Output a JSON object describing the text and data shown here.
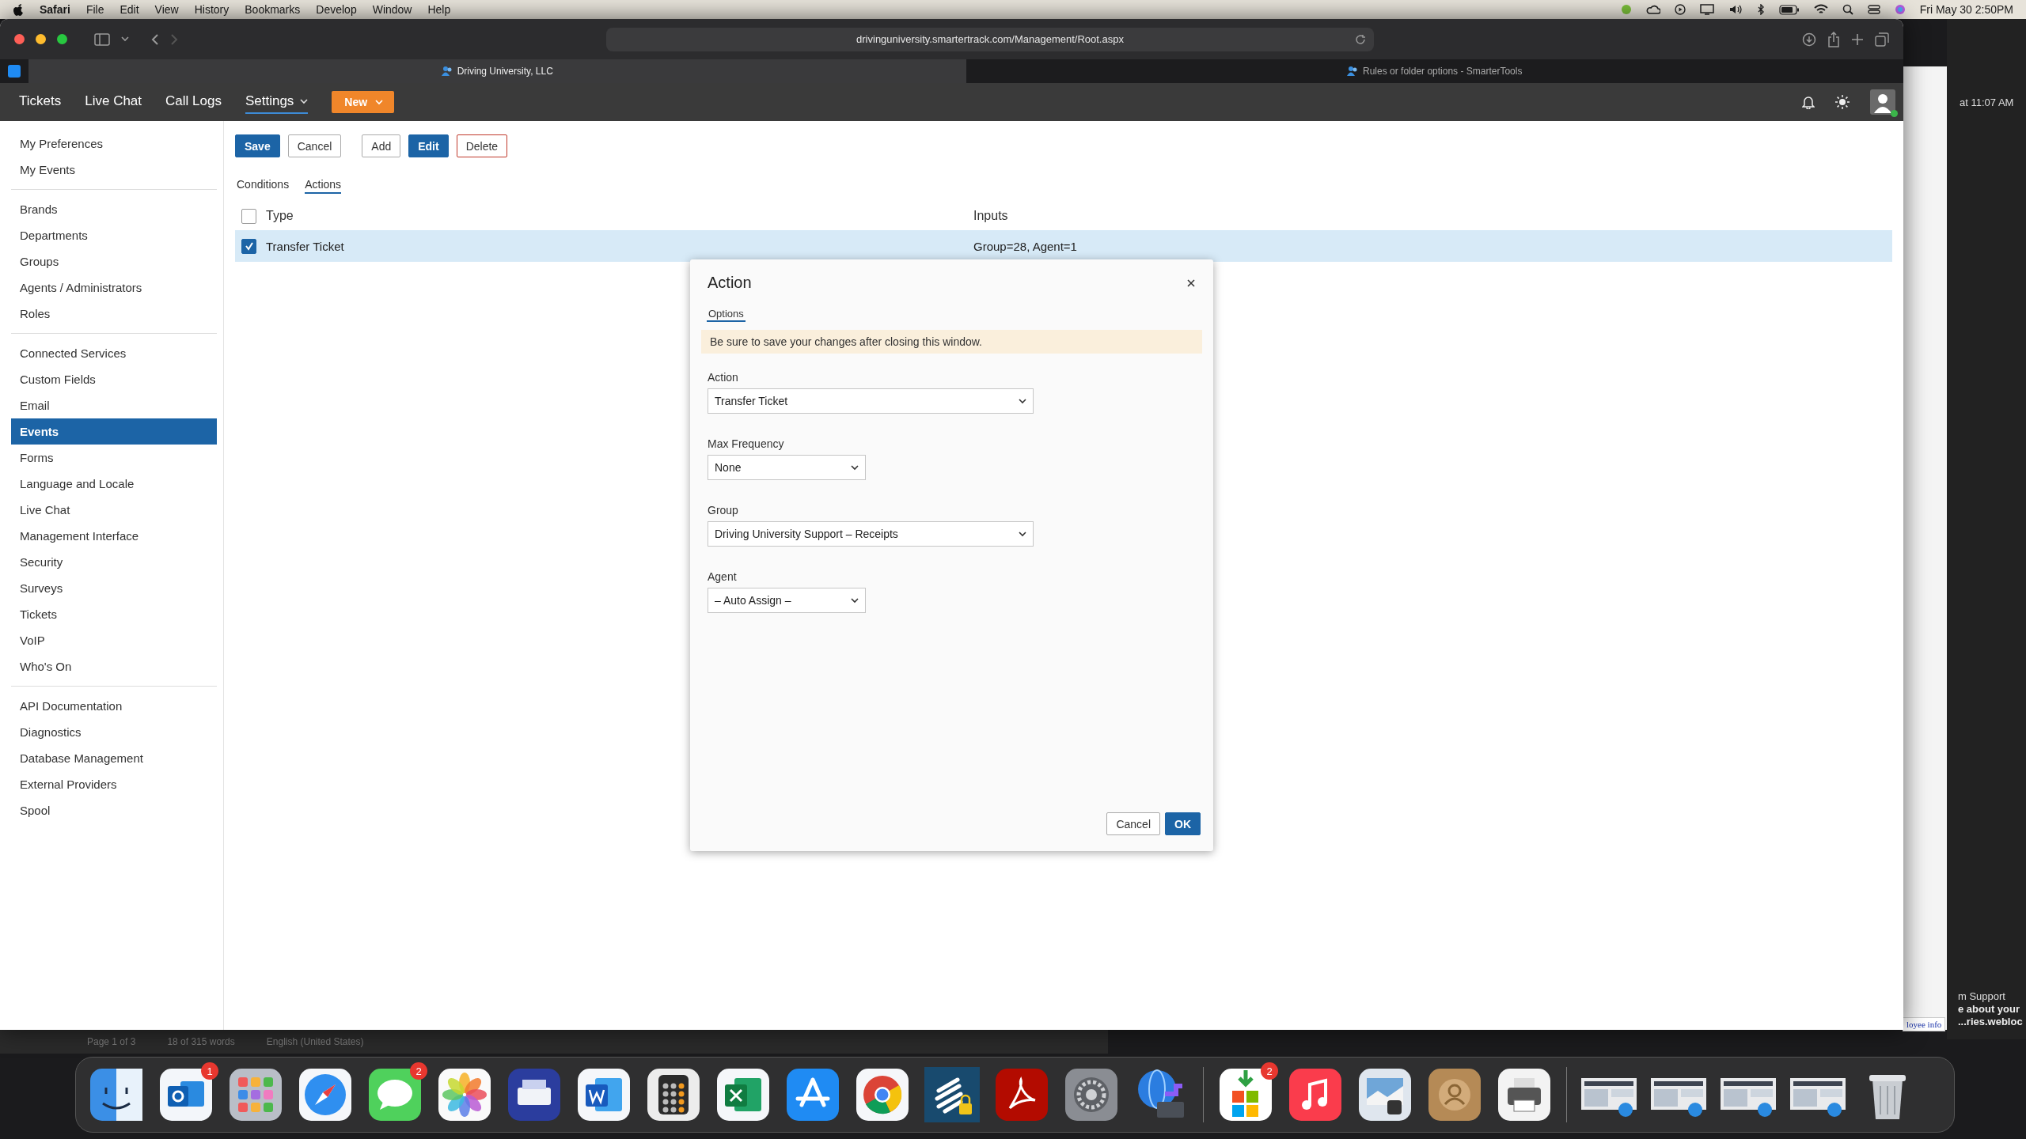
{
  "menubar": {
    "app": "Safari",
    "menus": [
      "File",
      "Edit",
      "View",
      "History",
      "Bookmarks",
      "Develop",
      "Window",
      "Help"
    ],
    "clock": "Fri May 30  2:50PM"
  },
  "browser": {
    "url": "drivinguniversity.smartertrack.com/Management/Root.aspx",
    "tabs": [
      {
        "label": "Driving University, LLC",
        "selected": true
      },
      {
        "label": "Rules or folder options - SmarterTools",
        "selected": false
      }
    ]
  },
  "app_nav": {
    "items": [
      {
        "label": "Tickets",
        "selected": false,
        "dropdown": false
      },
      {
        "label": "Live Chat",
        "selected": false,
        "dropdown": false
      },
      {
        "label": "Call Logs",
        "selected": false,
        "dropdown": false
      },
      {
        "label": "Settings",
        "selected": true,
        "dropdown": true
      }
    ],
    "new_button": "New"
  },
  "sidebar": {
    "groups": [
      {
        "items": [
          {
            "label": "My Preferences",
            "selected": false
          },
          {
            "label": "My Events",
            "selected": false
          }
        ]
      },
      {
        "items": [
          {
            "label": "Brands",
            "selected": false
          },
          {
            "label": "Departments",
            "selected": false
          },
          {
            "label": "Groups",
            "selected": false
          },
          {
            "label": "Agents / Administrators",
            "selected": false
          },
          {
            "label": "Roles",
            "selected": false
          }
        ]
      },
      {
        "items": [
          {
            "label": "Connected Services",
            "selected": false
          },
          {
            "label": "Custom Fields",
            "selected": false
          },
          {
            "label": "Email",
            "selected": false
          },
          {
            "label": "Events",
            "selected": true
          },
          {
            "label": "Forms",
            "selected": false
          },
          {
            "label": "Language and Locale",
            "selected": false
          },
          {
            "label": "Live Chat",
            "selected": false
          },
          {
            "label": "Management Interface",
            "selected": false
          },
          {
            "label": "Security",
            "selected": false
          },
          {
            "label": "Surveys",
            "selected": false
          },
          {
            "label": "Tickets",
            "selected": false
          },
          {
            "label": "VoIP",
            "selected": false
          },
          {
            "label": "Who's On",
            "selected": false
          }
        ]
      },
      {
        "items": [
          {
            "label": "API Documentation",
            "selected": false
          },
          {
            "label": "Diagnostics",
            "selected": false
          },
          {
            "label": "Database Management",
            "selected": false
          },
          {
            "label": "External Providers",
            "selected": false
          },
          {
            "label": "Spool",
            "selected": false
          }
        ]
      }
    ]
  },
  "toolbar": {
    "buttons": [
      {
        "label": "Save",
        "kind": "primary"
      },
      {
        "label": "Cancel",
        "kind": "default"
      },
      {
        "label": "Add",
        "kind": "default"
      },
      {
        "label": "Edit",
        "kind": "primary"
      },
      {
        "label": "Delete",
        "kind": "danger"
      }
    ]
  },
  "subtabs": [
    {
      "label": "Conditions",
      "selected": false
    },
    {
      "label": "Actions",
      "selected": true
    }
  ],
  "table": {
    "columns": [
      "Type",
      "Inputs"
    ],
    "header_checked": false,
    "rows": [
      {
        "type": "Transfer Ticket",
        "inputs": "Group=28, Agent=1",
        "checked": true,
        "selected": true
      }
    ]
  },
  "dialog": {
    "title": "Action",
    "tabs": [
      {
        "label": "Options",
        "selected": true
      }
    ],
    "notice": "Be sure to save your changes after closing this window.",
    "fields": [
      {
        "label": "Action",
        "value": "Transfer Ticket",
        "kind": "wide"
      },
      {
        "label": "Max Frequency",
        "value": "None",
        "kind": "narrow"
      },
      {
        "label": "Group",
        "value": "Driving University Support – Receipts",
        "kind": "wide"
      },
      {
        "label": "Agent",
        "value": "– Auto Assign –",
        "kind": "narrow"
      }
    ],
    "buttons": [
      {
        "label": "Cancel",
        "kind": "default"
      },
      {
        "label": "OK",
        "kind": "primary"
      }
    ]
  },
  "background_windows": {
    "time": "at 11:07 AM",
    "link": "loyee info",
    "lines": [
      "m Support",
      "e about your",
      "...ries.webloc"
    ],
    "status": [
      "Page 1 of 3",
      "18 of 315 words",
      "English (United States)"
    ]
  },
  "dock": {
    "items": [
      {
        "kind": "finder"
      },
      {
        "kind": "mail",
        "badge": "1"
      },
      {
        "kind": "grid"
      },
      {
        "kind": "compass"
      },
      {
        "kind": "chat",
        "badge": "2"
      },
      {
        "kind": "flower"
      },
      {
        "kind": "scanner"
      },
      {
        "kind": "word"
      },
      {
        "kind": "calculator"
      },
      {
        "kind": "sheet"
      },
      {
        "kind": "store"
      },
      {
        "kind": "chrome"
      },
      {
        "kind": "lock"
      },
      {
        "kind": "pdf"
      },
      {
        "kind": "gear"
      },
      {
        "kind": "globe"
      },
      {
        "kind": "separator"
      },
      {
        "kind": "download",
        "badge": "2"
      },
      {
        "kind": "music"
      },
      {
        "kind": "preview"
      },
      {
        "kind": "contacts"
      },
      {
        "kind": "printer"
      },
      {
        "kind": "separator"
      },
      {
        "kind": "thumbnail"
      },
      {
        "kind": "thumbnail"
      },
      {
        "kind": "thumbnail"
      },
      {
        "kind": "thumbnail"
      },
      {
        "kind": "trash"
      }
    ]
  }
}
